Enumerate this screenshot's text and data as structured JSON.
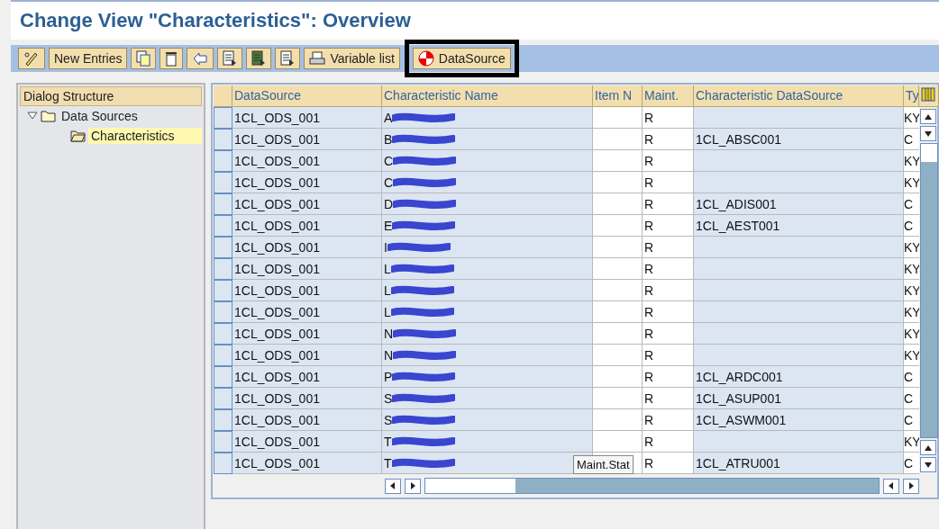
{
  "window": {
    "title": "Change View \"Characteristics\": Overview"
  },
  "toolbar": [
    {
      "kind": "icon"
    },
    {
      "kind": "text",
      "label": "New Entries"
    },
    {
      "kind": "icon"
    },
    {
      "kind": "icon"
    },
    {
      "kind": "icon"
    },
    {
      "kind": "icon"
    },
    {
      "kind": "icon"
    },
    {
      "kind": "icon"
    },
    {
      "kind": "text",
      "label": "Variable list"
    },
    {
      "kind": "text",
      "label": "DataSource",
      "highlighted": true
    }
  ],
  "dialog_structure": {
    "title": "Dialog Structure",
    "items": [
      {
        "label": "Data Sources",
        "expanded": true,
        "selected": false,
        "children": [
          {
            "label": "Characteristics",
            "selected": true
          }
        ]
      }
    ]
  },
  "table": {
    "columns": [
      "DataSource",
      "Characteristic Name",
      "Item N",
      "Maint.",
      "Characteristic DataSource",
      "Ty"
    ],
    "rows": [
      {
        "datasource": "1CL_ODS_001",
        "name": "A",
        "maint": "R",
        "type": "KY"
      },
      {
        "datasource": "1CL_ODS_001",
        "name": "B",
        "maint": "R",
        "char_ds": "1CL_ABSC001",
        "type": "C"
      },
      {
        "datasource": "1CL_ODS_001",
        "name": "C",
        "maint": "R",
        "type": "KY"
      },
      {
        "datasource": "1CL_ODS_001",
        "name": "C",
        "maint": "R",
        "type": "KY"
      },
      {
        "datasource": "1CL_ODS_001",
        "name": "D",
        "maint": "R",
        "char_ds": "1CL_ADIS001",
        "type": "C"
      },
      {
        "datasource": "1CL_ODS_001",
        "name": "E",
        "maint": "R",
        "char_ds": "1CL_AEST001",
        "type": "C"
      },
      {
        "datasource": "1CL_ODS_001",
        "name": "I",
        "maint": "R",
        "type": "KY"
      },
      {
        "datasource": "1CL_ODS_001",
        "name": "L",
        "maint": "R",
        "type": "KY"
      },
      {
        "datasource": "1CL_ODS_001",
        "name": "L",
        "maint": "R",
        "type": "KY"
      },
      {
        "datasource": "1CL_ODS_001",
        "name": "L",
        "maint": "R",
        "type": "KY"
      },
      {
        "datasource": "1CL_ODS_001",
        "name": "N",
        "maint": "R",
        "type": "KY"
      },
      {
        "datasource": "1CL_ODS_001",
        "name": "N",
        "maint": "R",
        "type": "KY"
      },
      {
        "datasource": "1CL_ODS_001",
        "name": "P",
        "maint": "R",
        "char_ds": "1CL_ARDC001",
        "type": "C"
      },
      {
        "datasource": "1CL_ODS_001",
        "name": "S",
        "maint": "R",
        "char_ds": "1CL_ASUP001",
        "type": "C"
      },
      {
        "datasource": "1CL_ODS_001",
        "name": "S",
        "maint": "R",
        "char_ds": "1CL_ASWM001",
        "type": "C"
      },
      {
        "datasource": "1CL_ODS_001",
        "name": "T",
        "maint": "R",
        "type": "KY"
      },
      {
        "datasource": "1CL_ODS_001",
        "name": "T",
        "maint": "R",
        "char_ds": "1CL_ATRU001",
        "type": "C"
      }
    ]
  },
  "tooltip": "Maint.Stat"
}
